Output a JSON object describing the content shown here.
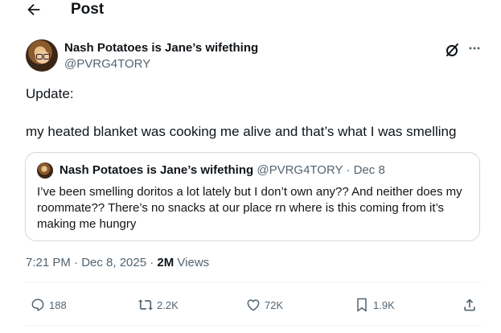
{
  "header": {
    "title": "Post"
  },
  "post": {
    "display_name": "Nash Potatoes is Jane’s wifething",
    "handle": "@PVRG4TORY",
    "text_line1": "Update:",
    "text_line2": "my heated blanket was cooking me alive and that’s what I was smelling"
  },
  "quote": {
    "display_name": "Nash Potatoes is Jane’s wifething",
    "meta": " @PVRG4TORY · Dec 8",
    "text": "I’ve been smelling doritos a lot lately but I don’t own any?? And neither does my roommate?? There’s no snacks at our place rn where is this coming from it’s making me hungry"
  },
  "timestamp": {
    "time_date": "7:21 PM · Dec 8, 2025 · ",
    "views_count": "2M",
    "views_label": " Views"
  },
  "actions": {
    "replies": "188",
    "reposts": "2.2K",
    "likes": "72K",
    "bookmarks": "1.9K"
  },
  "icons": {
    "back": "arrow-left-icon",
    "grok": "grok-icon",
    "more": "more-horizontal-icon",
    "reply": "reply-icon",
    "repost": "repost-icon",
    "like": "heart-icon",
    "bookmark": "bookmark-icon",
    "share": "share-icon"
  },
  "colors": {
    "text": "#0f1419",
    "secondary": "#536471",
    "border": "#cfd9de"
  }
}
